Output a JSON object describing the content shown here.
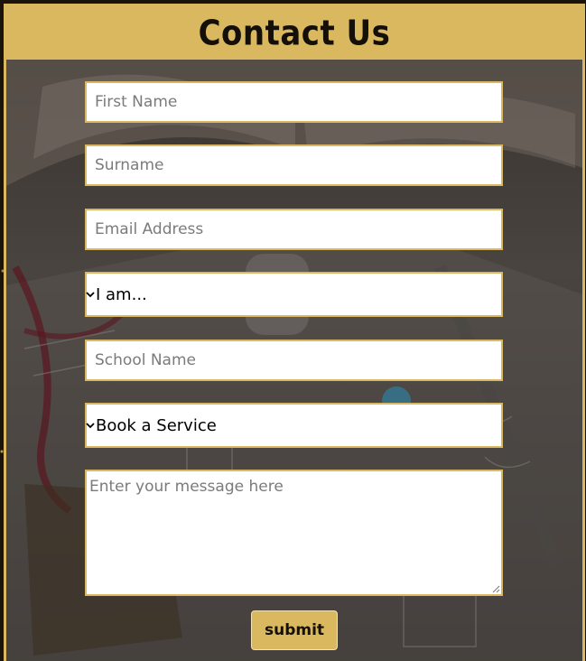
{
  "header": {
    "title": "Contact Us"
  },
  "form": {
    "first_name": {
      "placeholder": "First Name",
      "value": ""
    },
    "surname": {
      "placeholder": "Surname",
      "value": ""
    },
    "email": {
      "placeholder": "Email Address",
      "value": ""
    },
    "role_select": {
      "selected": "I am..."
    },
    "school_name": {
      "placeholder": "School Name",
      "value": ""
    },
    "service_select": {
      "selected": "Book a Service"
    },
    "message": {
      "placeholder": "Enter your message here",
      "value": ""
    },
    "submit_label": "submit"
  },
  "colors": {
    "accent": "#d9b860",
    "header_text": "#141009",
    "frame": "#1b140c"
  },
  "icons": [
    "chevron-down-icon",
    "resize-grip-icon"
  ]
}
